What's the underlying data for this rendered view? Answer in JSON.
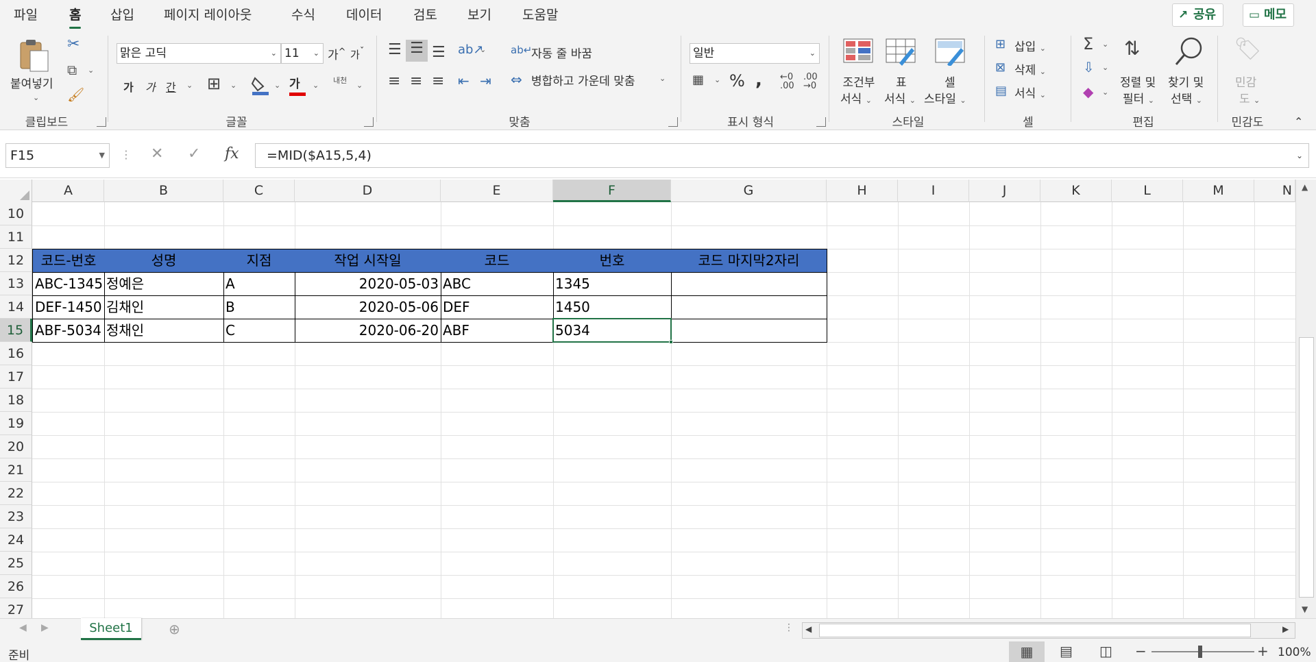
{
  "tabs": [
    "파일",
    "홈",
    "삽입",
    "페이지 레이아웃",
    "수식",
    "데이터",
    "검토",
    "보기",
    "도움말"
  ],
  "active_tab": "홈",
  "share_label": "공유",
  "memo_label": "메모",
  "ribbon": {
    "clipboard": {
      "paste": "붙여넣기",
      "group": "클립보드"
    },
    "font": {
      "name": "맑은 고딕",
      "size": "11",
      "grow": "가",
      "shrink": "가",
      "bold": "가",
      "italic": "가",
      "underline": "간",
      "phonetic_top": "내천",
      "group": "글꼴"
    },
    "alignment": {
      "wrap": "자동 줄 바꿈",
      "merge": "병합하고 가운데 맞춤",
      "group": "맞춤"
    },
    "number": {
      "format": "일반",
      "group": "표시 형식"
    },
    "styles": {
      "cond_l1": "조건부",
      "cond_l2": "서식",
      "table_l1": "표",
      "table_l2": "서식",
      "cell_l1": "셀",
      "cell_l2": "스타일",
      "group": "스타일"
    },
    "cells": {
      "insert": "삽입",
      "delete": "삭제",
      "format": "서식",
      "group": "셀"
    },
    "editing": {
      "sort_l1": "정렬 및",
      "sort_l2": "필터",
      "find_l1": "찾기 및",
      "find_l2": "선택",
      "group": "편집"
    },
    "sensitivity": {
      "label_l1": "민감",
      "label_l2": "도",
      "group": "민감도"
    }
  },
  "formula_bar": {
    "name_box": "F15",
    "formula": "=MID($A15,5,4)"
  },
  "columns": [
    "A",
    "B",
    "C",
    "D",
    "E",
    "F",
    "G",
    "H",
    "I",
    "J",
    "K",
    "L",
    "M",
    "N"
  ],
  "rows": [
    "10",
    "11",
    "12",
    "13",
    "14",
    "15",
    "16",
    "17",
    "18",
    "19",
    "20",
    "21",
    "22",
    "23",
    "24",
    "25",
    "26",
    "27"
  ],
  "selected_cell": "F15",
  "table": {
    "headers": [
      "코드-번호",
      "성명",
      "지점",
      "작업 시작일",
      "코드",
      "번호",
      "코드 마지막2자리"
    ],
    "rows": [
      [
        "ABC-1345",
        "정예은",
        "A",
        "2020-05-03",
        "ABC",
        "1345",
        ""
      ],
      [
        "DEF-1450",
        "김채인",
        "B",
        "2020-05-06",
        "DEF",
        "1450",
        ""
      ],
      [
        "ABF-5034",
        "정채인",
        "C",
        "2020-06-20",
        "ABF",
        "5034",
        ""
      ]
    ]
  },
  "header_fill": "#4472C4",
  "accent": "#217346",
  "sheet_tab": "Sheet1",
  "status": {
    "ready": "준비",
    "zoom": "100%"
  }
}
